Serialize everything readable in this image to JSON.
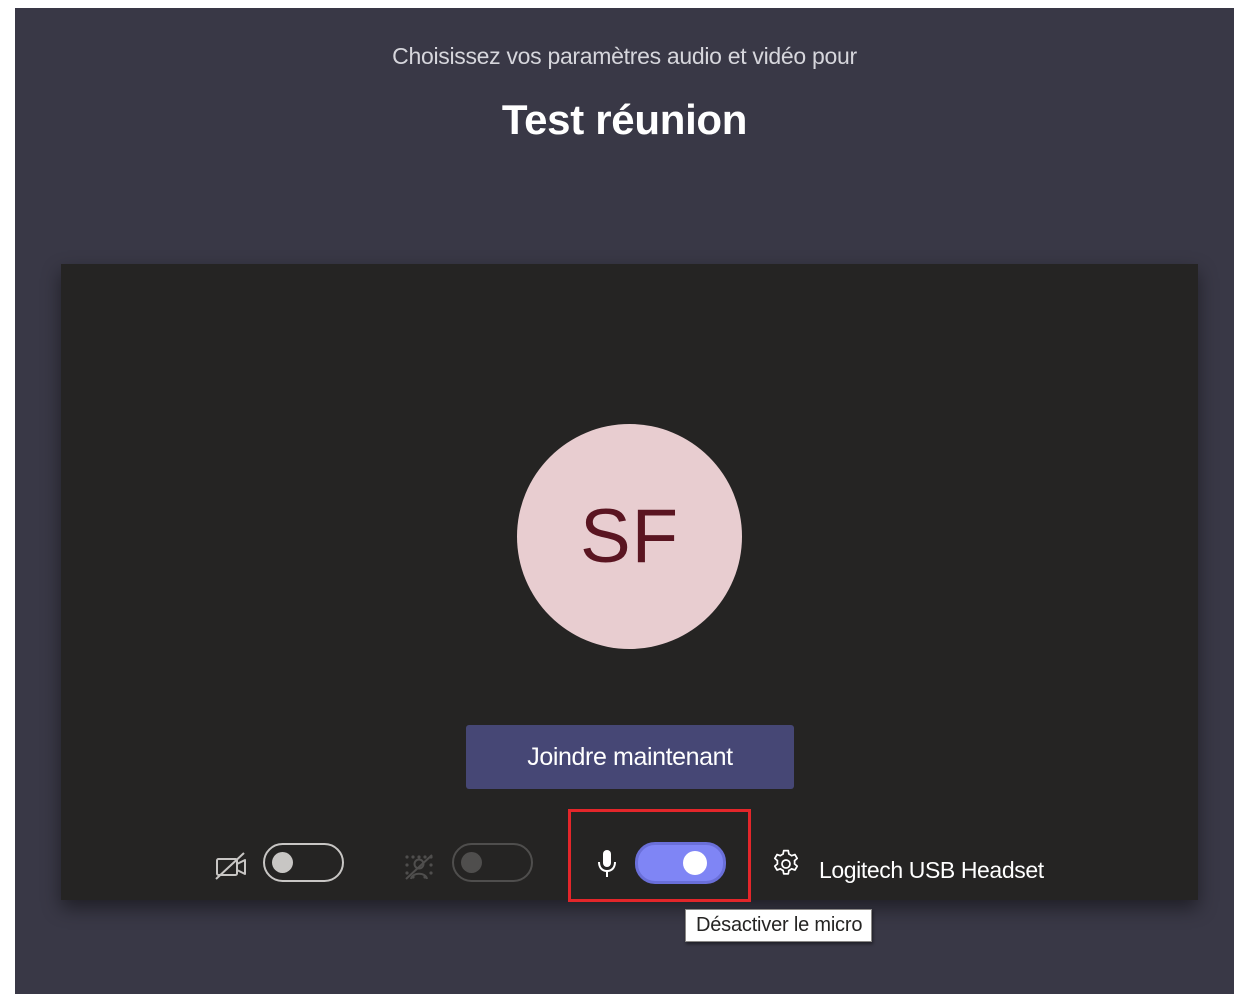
{
  "header": {
    "subtitle": "Choisissez vos paramètres audio et vidéo pour",
    "meeting_title": "Test réunion"
  },
  "preview": {
    "avatar_initials": "SF",
    "avatar_bg_color": "#e8cdd0",
    "avatar_text_color": "#5a1521"
  },
  "join_button": {
    "label": "Joindre maintenant",
    "color": "#464775"
  },
  "controls": {
    "camera": {
      "icon": "camera-off-icon",
      "toggle_state": "off"
    },
    "background_blur": {
      "icon": "background-blur-icon",
      "toggle_state": "disabled"
    },
    "microphone": {
      "icon": "microphone-icon",
      "toggle_state": "on",
      "toggle_color": "#7f85f5"
    },
    "device_settings": {
      "icon": "gear-icon",
      "label": "Logitech USB Headset"
    }
  },
  "tooltip": {
    "text": "Désactiver le micro"
  },
  "colors": {
    "background": "#393846",
    "preview_background": "#252423",
    "highlight_border": "#e3262a"
  }
}
